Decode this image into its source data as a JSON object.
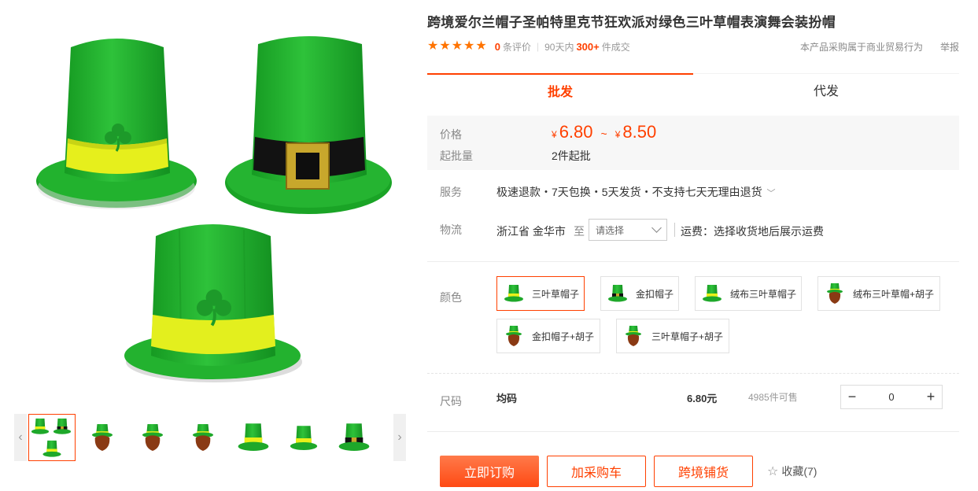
{
  "product": {
    "title": "跨境爱尔兰帽子圣帕特里克节狂欢派对绿色三叶草帽表演舞会装扮帽"
  },
  "rating": {
    "stars": 5,
    "review_count": "0",
    "review_suffix": "条评价",
    "days_prefix": "90天内",
    "sold_count": "300+",
    "sold_suffix": "件成交",
    "trade_note": "本产品采购属于商业贸易行为",
    "report_label": "举报"
  },
  "tabs": [
    {
      "label": "批发",
      "active": true
    },
    {
      "label": "代发",
      "active": false
    }
  ],
  "price": {
    "label": "价格",
    "currency": "¥",
    "min": "6.80",
    "max": "8.50",
    "tilde": "~",
    "moq_label": "起批量",
    "moq_value": "2件起批"
  },
  "service": {
    "label": "服务",
    "text": "极速退款・7天包换・5天发货・不支持七天无理由退货"
  },
  "logistics": {
    "label": "物流",
    "origin": "浙江省 金华市",
    "to": "至",
    "select_placeholder": "请选择",
    "freight": "运费：选择收货地后展示运费"
  },
  "colors": {
    "label": "颜色",
    "options": [
      {
        "label": "三叶草帽子",
        "active": true
      },
      {
        "label": "金扣帽子",
        "active": false
      },
      {
        "label": "绒布三叶草帽子",
        "active": false
      },
      {
        "label": "绒布三叶草帽+胡子",
        "active": false
      },
      {
        "label": "金扣帽子+胡子",
        "active": false
      },
      {
        "label": "三叶草帽子+胡子",
        "active": false
      }
    ]
  },
  "size": {
    "label": "尺码",
    "name": "均码",
    "price": "6.80元",
    "stock": "4985件可售",
    "quantity": "0",
    "minus": "−",
    "plus": "+"
  },
  "actions": {
    "buy": "立即订购",
    "cart": "加采购车",
    "crossborder": "跨境铺货",
    "favorite": "收藏(7)"
  },
  "colors_hex": {
    "accent": "#ff4000",
    "hat_green": "#22b22e",
    "band_yellow": "#e8f01a"
  }
}
